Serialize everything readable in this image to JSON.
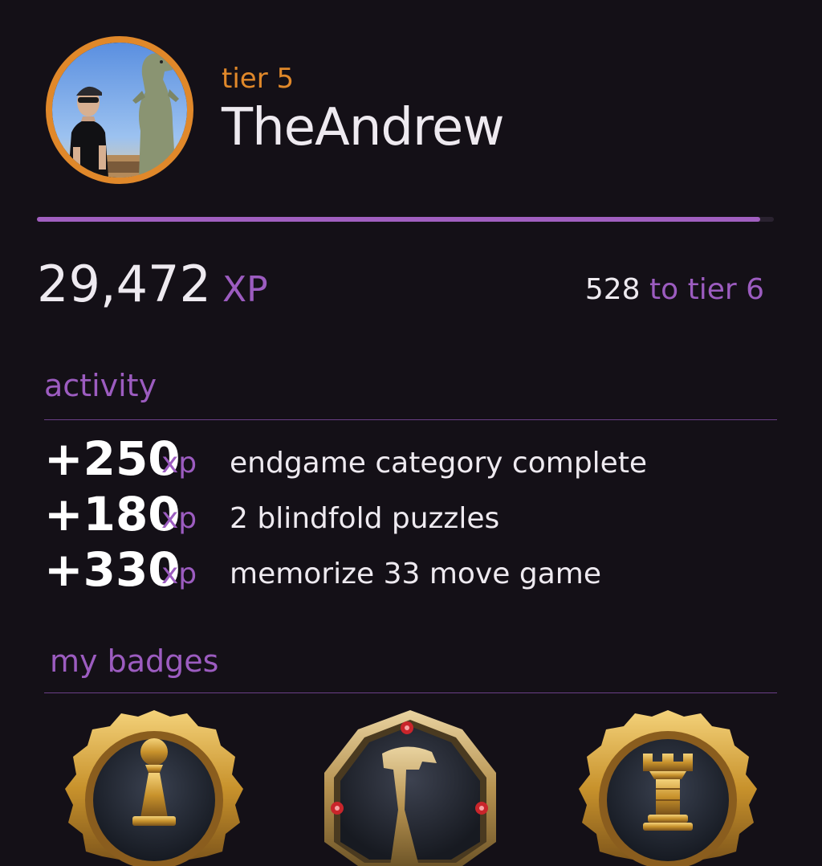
{
  "profile": {
    "tier_label": "tier 5",
    "username": "TheAndrew",
    "avatar_alt": "avatar",
    "progress_fraction": 0.982
  },
  "xp": {
    "total": "29,472",
    "unit": "XP",
    "remaining": "528",
    "remaining_suffix": "to tier 6"
  },
  "activity": {
    "heading": "activity",
    "items": [
      {
        "amount": "+250",
        "unit": "xp",
        "description": "endgame category complete"
      },
      {
        "amount": "+180",
        "unit": "xp",
        "description": "2 blindfold puzzles"
      },
      {
        "amount": "+330",
        "unit": "xp",
        "description": "memorize 33 move game"
      }
    ]
  },
  "badges": {
    "heading": "my badges",
    "items": [
      {
        "icon": "pawn-badge-icon"
      },
      {
        "icon": "knight-badge-icon"
      },
      {
        "icon": "rook-badge-icon"
      }
    ]
  },
  "colors": {
    "background": "#141017",
    "accent_purple": "#9c5cc0",
    "accent_orange": "#e0882a",
    "text": "#eeeaf0",
    "gold": "#d8a43a"
  }
}
